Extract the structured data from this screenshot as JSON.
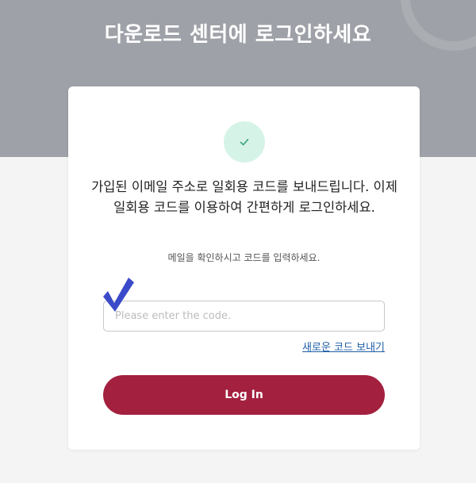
{
  "header": {
    "title": "다운로드 센터에 로그인하세요"
  },
  "card": {
    "headline": "가입된 이메일 주소로 일회용 코드를 보내드립니다. 이제 일회용 코드를 이용하여 간편하게 로그인하세요.",
    "subtext": "메일을 확인하시고 코드를 입력하세요.",
    "code_input": {
      "value": "",
      "placeholder": "Please enter the code."
    },
    "resend_link": "새로운 코드 보내기",
    "login_button": "Log In"
  },
  "icons": {
    "status": "check-icon",
    "annotation": "checkmark-annotation-icon"
  },
  "colors": {
    "hero_bg": "#9ea1a7",
    "page_bg": "#f4f4f5",
    "primary": "#a3203f",
    "link": "#1f5fa8",
    "check_bg": "#d6f3e7",
    "check_fg": "#3aa57a",
    "annotation": "#3b4ac9"
  }
}
